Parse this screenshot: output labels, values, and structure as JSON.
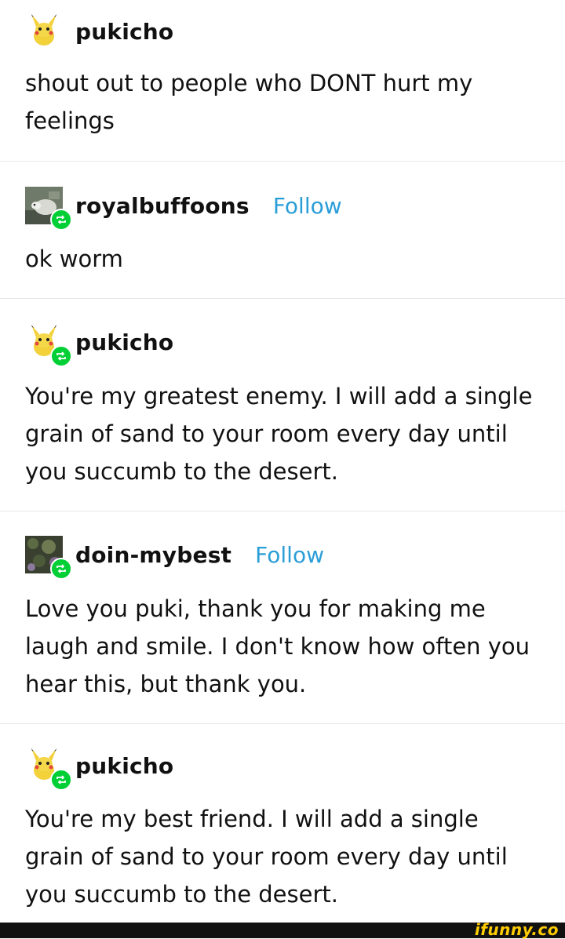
{
  "posts": [
    {
      "username": "pukicho",
      "avatar": "pikachu-avatar",
      "reblog": false,
      "follow": "",
      "text": "shout out to people who DONT hurt my feelings"
    },
    {
      "username": "royalbuffoons",
      "avatar": "possum-photo-avatar",
      "reblog": true,
      "follow": "Follow",
      "text": "ok worm"
    },
    {
      "username": "pukicho",
      "avatar": "pikachu-avatar",
      "reblog": true,
      "follow": "",
      "text": "You're my greatest enemy. I will add a single grain of sand to your room every day until you succumb to the desert."
    },
    {
      "username": "doin-mybest",
      "avatar": "nature-photo-avatar",
      "reblog": true,
      "follow": "Follow",
      "text": "Love you puki, thank you for making me laugh and smile. I don't know how often you hear this, but thank you."
    },
    {
      "username": "pukicho",
      "avatar": "pikachu-avatar",
      "reblog": true,
      "follow": "",
      "text": "You're my best friend. I will add a single grain of sand to your room every day until you succumb to the desert."
    }
  ],
  "watermark": "ifunny.co",
  "colors": {
    "follow": "#2b9ed8",
    "reblog_badge": "#00cf35",
    "divider": "#e8e8e8"
  }
}
